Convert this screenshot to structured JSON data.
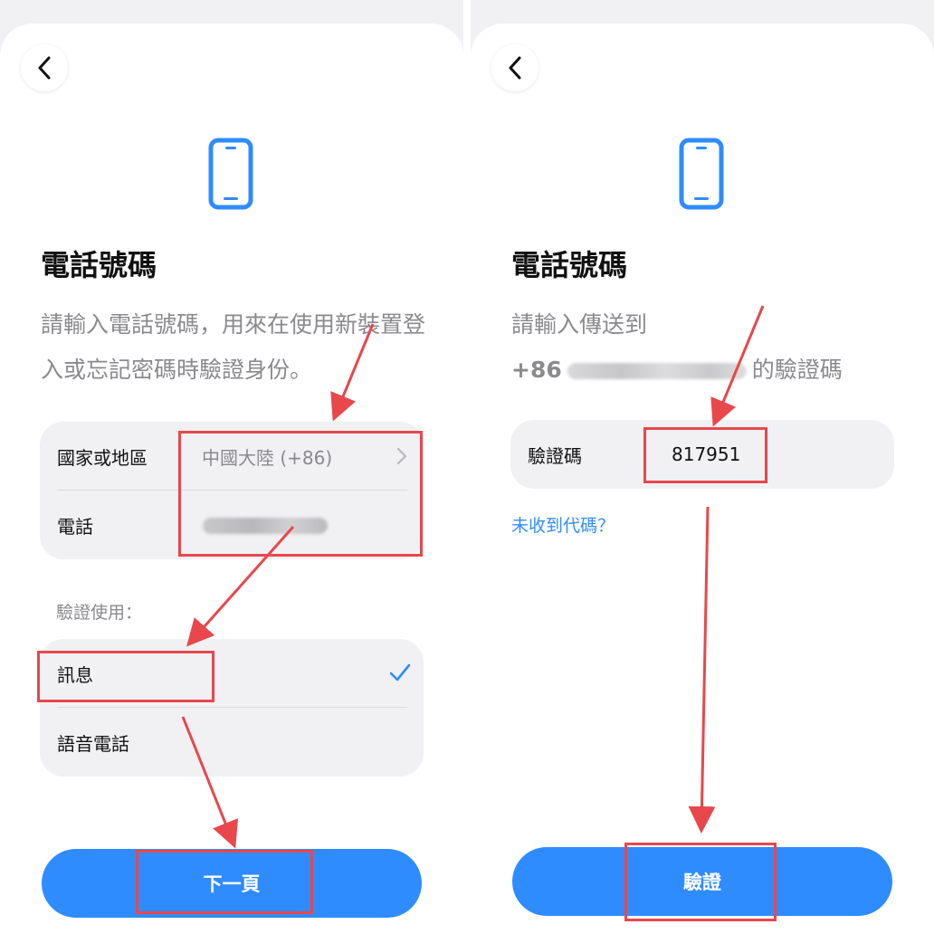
{
  "left_screen": {
    "title": "電話號碼",
    "description": "請輸入電話號碼，用來在使用新裝置登入或忘記密碼時驗證身份。",
    "country_row": {
      "label": "國家或地區",
      "value": "中國大陸 (+86)"
    },
    "phone_row": {
      "label": "電話"
    },
    "verify_with_label": "驗證使用：",
    "options": [
      {
        "label": "訊息",
        "selected": true
      },
      {
        "label": "語音電話",
        "selected": false
      }
    ],
    "next_button_label": "下一頁"
  },
  "right_screen": {
    "title": "電話號碼",
    "description_line1": "請輸入傳送到",
    "country_code": "+86",
    "description_suffix": "的驗證碼",
    "code_row": {
      "label": "驗證碼",
      "value": "817951"
    },
    "resend_link": "未收到代碼？",
    "verify_button_label": "驗證"
  },
  "colors": {
    "accent": "#2f8cff",
    "annotation": "#e8474c"
  },
  "icons": [
    "back-icon",
    "phone-icon",
    "chevron-right-icon",
    "checkmark-icon"
  ]
}
